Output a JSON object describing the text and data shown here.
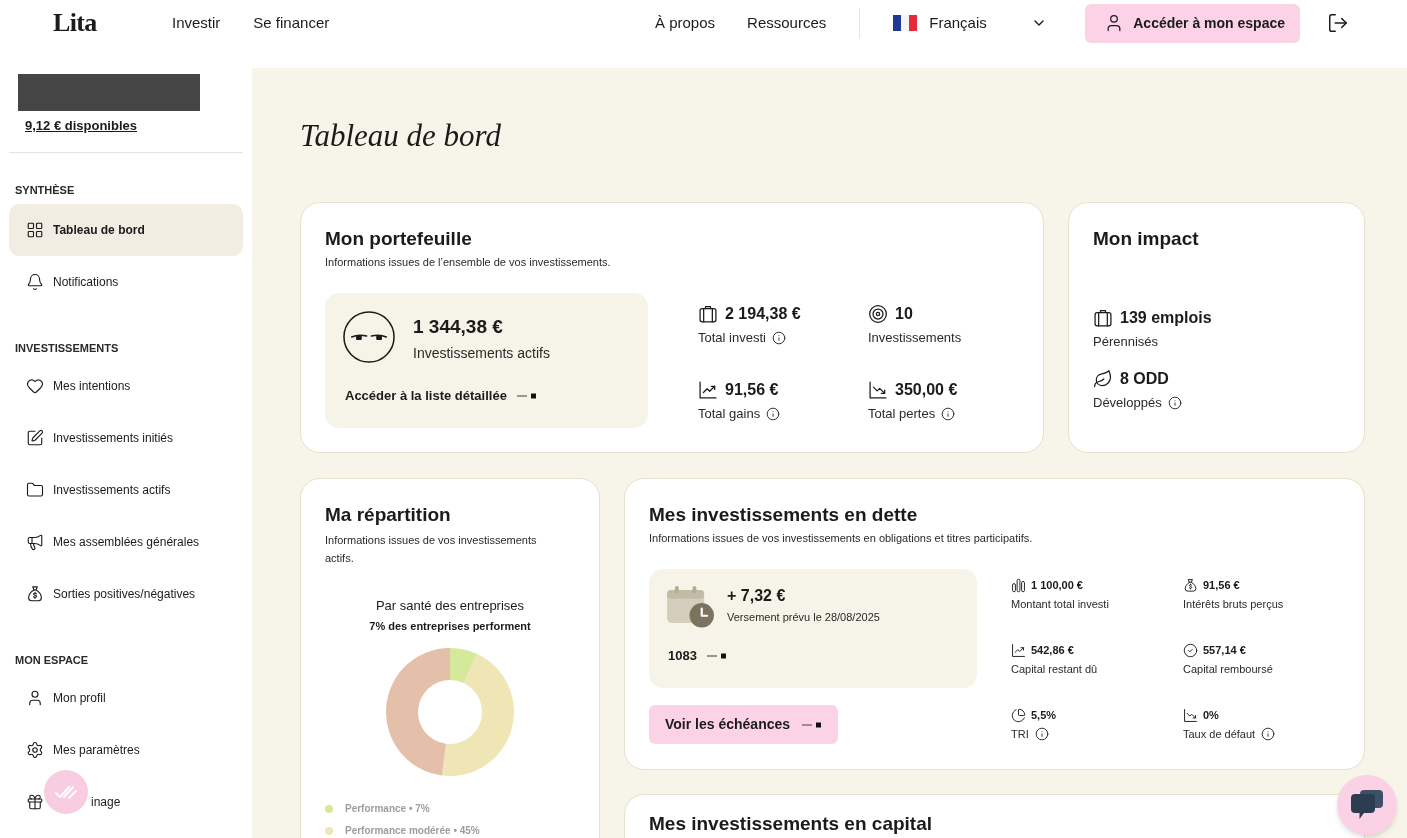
{
  "header": {
    "logo": "Lita",
    "nav_left": [
      "Investir",
      "Se financer"
    ],
    "nav_right": [
      "À propos",
      "Ressources"
    ],
    "language": "Français",
    "account_button": "Accéder à mon espace"
  },
  "sidebar": {
    "balance": "9,12 € disponibles",
    "sections": [
      {
        "title": "SYNTHÈSE",
        "items": [
          {
            "label": "Tableau de bord",
            "selected": true
          },
          {
            "label": "Notifications",
            "selected": false
          }
        ]
      },
      {
        "title": "INVESTISSEMENTS",
        "items": [
          {
            "label": "Mes intentions",
            "selected": false
          },
          {
            "label": "Investissements initiés",
            "selected": false
          },
          {
            "label": "Investissements actifs",
            "selected": false
          },
          {
            "label": "Mes assemblées générales",
            "selected": false
          },
          {
            "label": "Sorties positives/négatives",
            "selected": false
          }
        ]
      },
      {
        "title": "MON ESPACE",
        "items": [
          {
            "label": "Mon profil",
            "selected": false
          },
          {
            "label": "Mes paramètres",
            "selected": false
          },
          {
            "label": "inage",
            "selected": false
          }
        ]
      }
    ]
  },
  "page_title": "Tableau de bord",
  "portfolio": {
    "title": "Mon portefeuille",
    "subtitle": "Informations issues de l’ensemble de vos investissements.",
    "highlight": {
      "value": "1 344,38 €",
      "label": "Investissements actifs",
      "link": "Accéder à la liste détaillée"
    },
    "stats": [
      {
        "value": "2 194,38 €",
        "label": "Total investi",
        "info": true
      },
      {
        "value": "10",
        "label": "Investissements",
        "info": false
      },
      {
        "value": "91,56 €",
        "label": "Total gains",
        "info": true
      },
      {
        "value": "350,00 €",
        "label": "Total pertes",
        "info": true
      }
    ]
  },
  "impact": {
    "title": "Mon impact",
    "items": [
      {
        "value": "139 emplois",
        "label": "Pérennisés",
        "info": false
      },
      {
        "value": "8 ODD",
        "label": "Développés",
        "info": true
      }
    ]
  },
  "repartition": {
    "title": "Ma répartition",
    "subtitle": "Informations issues de vos investissements actifs.",
    "chart_subtitle": "7% des entreprises performent",
    "chart_data": {
      "type": "donut",
      "title": "Par santé des entreprises",
      "values": [
        7,
        45,
        48
      ],
      "colors": [
        "#d5e99a",
        "#efe5b5",
        "#e4bfa9"
      ]
    },
    "legend": [
      {
        "label": "Performance • 7%",
        "color": "#d5e99a"
      },
      {
        "label": "Performance modérée • 45%",
        "color": "#efe5b5"
      }
    ]
  },
  "debt": {
    "title": "Mes investissements en dette",
    "subtitle": "Informations issues de vos investissements en obligations et titres participatifs.",
    "next_payment": {
      "amount": "+ 7,32 €",
      "label": "Versement prévu le 28/08/2025",
      "count": "1083"
    },
    "button": "Voir les échéances",
    "stats": [
      {
        "value": "1 100,00 €",
        "label": "Montant total investi",
        "info": false
      },
      {
        "value": "91,56 €",
        "label": "Intérêts bruts perçus",
        "info": false
      },
      {
        "value": "542,86 €",
        "label": "Capital restant dû",
        "info": false
      },
      {
        "value": "557,14 €",
        "label": "Capital remboursé",
        "info": false
      },
      {
        "value": "5,5%",
        "label": "TRI",
        "info": true
      },
      {
        "value": "0%",
        "label": "Taux de défaut",
        "info": true
      }
    ]
  },
  "capital": {
    "title": "Mes investissements en capital"
  }
}
